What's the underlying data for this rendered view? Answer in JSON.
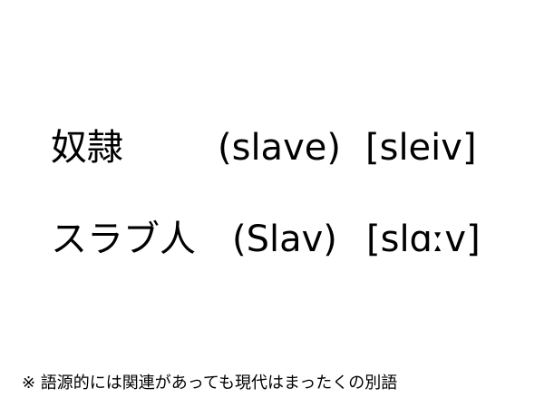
{
  "entries": [
    {
      "term": "奴隷",
      "gloss": "(slave)",
      "ipa": "[sleiv]"
    },
    {
      "term": "スラブ人",
      "gloss": "(Slav)",
      "ipa": "[slɑːv]"
    }
  ],
  "note": "※ 語源的には関連があっても現代はまったくの別語"
}
